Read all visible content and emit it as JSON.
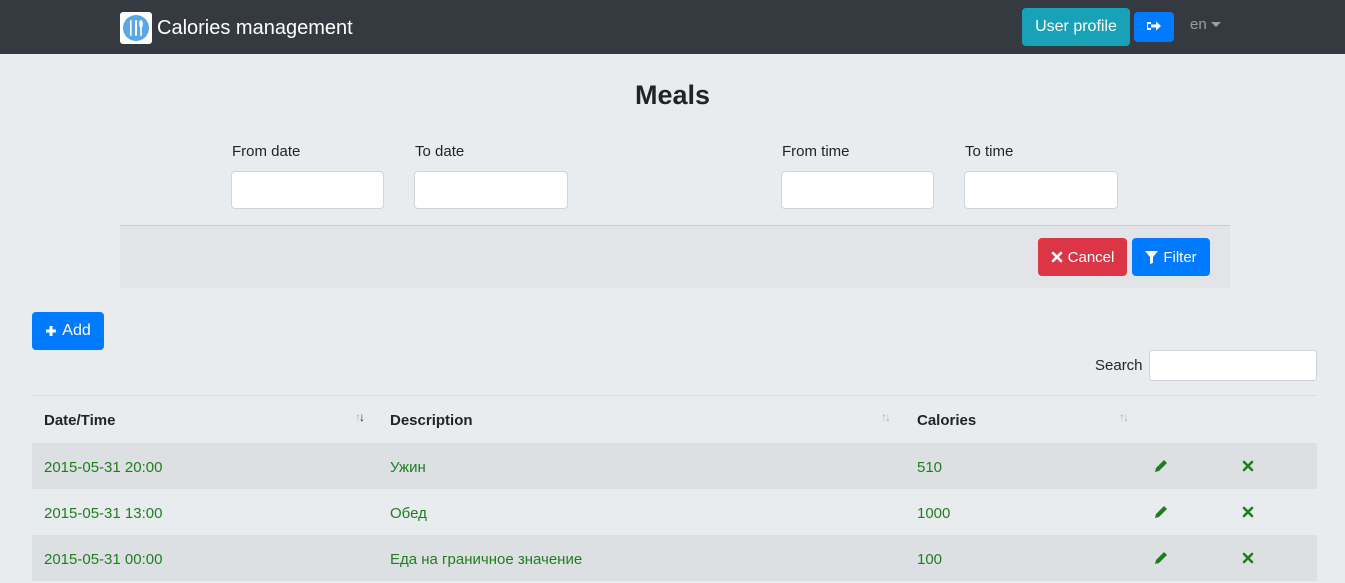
{
  "navbar": {
    "brand": "Calories management",
    "user_profile_label": "User profile",
    "language": "en"
  },
  "page": {
    "title": "Meals"
  },
  "filter": {
    "from_date_label": "From date",
    "to_date_label": "To date",
    "from_time_label": "From time",
    "to_time_label": "To time",
    "from_date_value": "",
    "to_date_value": "",
    "from_time_value": "",
    "to_time_value": "",
    "cancel_label": "Cancel",
    "filter_label": "Filter"
  },
  "toolbar": {
    "add_label": "Add",
    "search_label": "Search",
    "search_value": ""
  },
  "table": {
    "headers": [
      "Date/Time",
      "Description",
      "Calories"
    ],
    "rows": [
      {
        "datetime": "2015-05-31 20:00",
        "description": "Ужин",
        "calories": "510"
      },
      {
        "datetime": "2015-05-31 13:00",
        "description": "Обед",
        "calories": "1000"
      },
      {
        "datetime": "2015-05-31 00:00",
        "description": "Еда на граничное значение",
        "calories": "100"
      }
    ]
  },
  "colors": {
    "navbar": "#343a40",
    "primary": "#007bff",
    "info": "#17a2b8",
    "danger": "#dc3545",
    "row_text": "#1e7e1e"
  },
  "icons": {
    "logo": "fork-knife-icon",
    "logout": "sign-out-icon",
    "cancel": "times-icon",
    "filter": "filter-icon",
    "add": "plus-icon",
    "edit": "pencil-icon",
    "delete": "times-icon"
  }
}
